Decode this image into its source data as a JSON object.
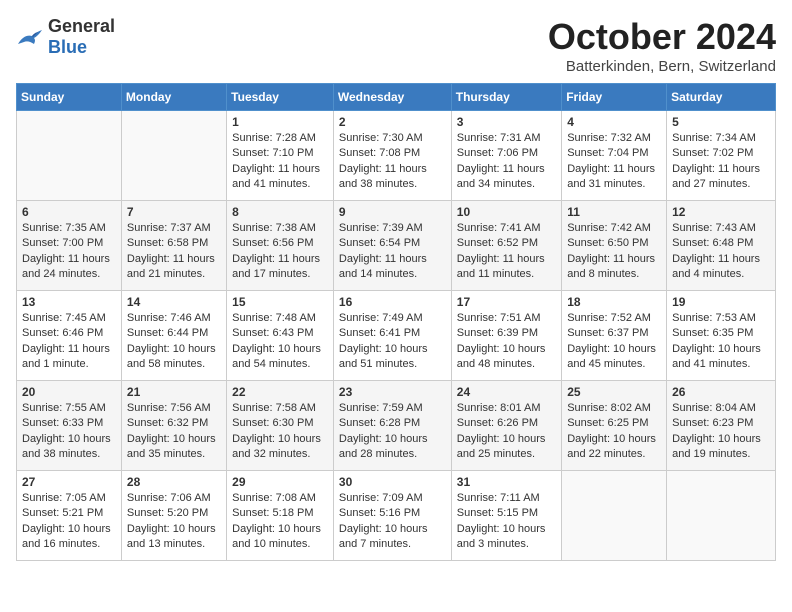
{
  "header": {
    "logo_general": "General",
    "logo_blue": "Blue",
    "month_title": "October 2024",
    "subtitle": "Batterkinden, Bern, Switzerland"
  },
  "days_of_week": [
    "Sunday",
    "Monday",
    "Tuesday",
    "Wednesday",
    "Thursday",
    "Friday",
    "Saturday"
  ],
  "weeks": [
    [
      {
        "day": "",
        "info": ""
      },
      {
        "day": "",
        "info": ""
      },
      {
        "day": "1",
        "info": "Sunrise: 7:28 AM\nSunset: 7:10 PM\nDaylight: 11 hours and 41 minutes."
      },
      {
        "day": "2",
        "info": "Sunrise: 7:30 AM\nSunset: 7:08 PM\nDaylight: 11 hours and 38 minutes."
      },
      {
        "day": "3",
        "info": "Sunrise: 7:31 AM\nSunset: 7:06 PM\nDaylight: 11 hours and 34 minutes."
      },
      {
        "day": "4",
        "info": "Sunrise: 7:32 AM\nSunset: 7:04 PM\nDaylight: 11 hours and 31 minutes."
      },
      {
        "day": "5",
        "info": "Sunrise: 7:34 AM\nSunset: 7:02 PM\nDaylight: 11 hours and 27 minutes."
      }
    ],
    [
      {
        "day": "6",
        "info": "Sunrise: 7:35 AM\nSunset: 7:00 PM\nDaylight: 11 hours and 24 minutes."
      },
      {
        "day": "7",
        "info": "Sunrise: 7:37 AM\nSunset: 6:58 PM\nDaylight: 11 hours and 21 minutes."
      },
      {
        "day": "8",
        "info": "Sunrise: 7:38 AM\nSunset: 6:56 PM\nDaylight: 11 hours and 17 minutes."
      },
      {
        "day": "9",
        "info": "Sunrise: 7:39 AM\nSunset: 6:54 PM\nDaylight: 11 hours and 14 minutes."
      },
      {
        "day": "10",
        "info": "Sunrise: 7:41 AM\nSunset: 6:52 PM\nDaylight: 11 hours and 11 minutes."
      },
      {
        "day": "11",
        "info": "Sunrise: 7:42 AM\nSunset: 6:50 PM\nDaylight: 11 hours and 8 minutes."
      },
      {
        "day": "12",
        "info": "Sunrise: 7:43 AM\nSunset: 6:48 PM\nDaylight: 11 hours and 4 minutes."
      }
    ],
    [
      {
        "day": "13",
        "info": "Sunrise: 7:45 AM\nSunset: 6:46 PM\nDaylight: 11 hours and 1 minute."
      },
      {
        "day": "14",
        "info": "Sunrise: 7:46 AM\nSunset: 6:44 PM\nDaylight: 10 hours and 58 minutes."
      },
      {
        "day": "15",
        "info": "Sunrise: 7:48 AM\nSunset: 6:43 PM\nDaylight: 10 hours and 54 minutes."
      },
      {
        "day": "16",
        "info": "Sunrise: 7:49 AM\nSunset: 6:41 PM\nDaylight: 10 hours and 51 minutes."
      },
      {
        "day": "17",
        "info": "Sunrise: 7:51 AM\nSunset: 6:39 PM\nDaylight: 10 hours and 48 minutes."
      },
      {
        "day": "18",
        "info": "Sunrise: 7:52 AM\nSunset: 6:37 PM\nDaylight: 10 hours and 45 minutes."
      },
      {
        "day": "19",
        "info": "Sunrise: 7:53 AM\nSunset: 6:35 PM\nDaylight: 10 hours and 41 minutes."
      }
    ],
    [
      {
        "day": "20",
        "info": "Sunrise: 7:55 AM\nSunset: 6:33 PM\nDaylight: 10 hours and 38 minutes."
      },
      {
        "day": "21",
        "info": "Sunrise: 7:56 AM\nSunset: 6:32 PM\nDaylight: 10 hours and 35 minutes."
      },
      {
        "day": "22",
        "info": "Sunrise: 7:58 AM\nSunset: 6:30 PM\nDaylight: 10 hours and 32 minutes."
      },
      {
        "day": "23",
        "info": "Sunrise: 7:59 AM\nSunset: 6:28 PM\nDaylight: 10 hours and 28 minutes."
      },
      {
        "day": "24",
        "info": "Sunrise: 8:01 AM\nSunset: 6:26 PM\nDaylight: 10 hours and 25 minutes."
      },
      {
        "day": "25",
        "info": "Sunrise: 8:02 AM\nSunset: 6:25 PM\nDaylight: 10 hours and 22 minutes."
      },
      {
        "day": "26",
        "info": "Sunrise: 8:04 AM\nSunset: 6:23 PM\nDaylight: 10 hours and 19 minutes."
      }
    ],
    [
      {
        "day": "27",
        "info": "Sunrise: 7:05 AM\nSunset: 5:21 PM\nDaylight: 10 hours and 16 minutes."
      },
      {
        "day": "28",
        "info": "Sunrise: 7:06 AM\nSunset: 5:20 PM\nDaylight: 10 hours and 13 minutes."
      },
      {
        "day": "29",
        "info": "Sunrise: 7:08 AM\nSunset: 5:18 PM\nDaylight: 10 hours and 10 minutes."
      },
      {
        "day": "30",
        "info": "Sunrise: 7:09 AM\nSunset: 5:16 PM\nDaylight: 10 hours and 7 minutes."
      },
      {
        "day": "31",
        "info": "Sunrise: 7:11 AM\nSunset: 5:15 PM\nDaylight: 10 hours and 3 minutes."
      },
      {
        "day": "",
        "info": ""
      },
      {
        "day": "",
        "info": ""
      }
    ]
  ]
}
